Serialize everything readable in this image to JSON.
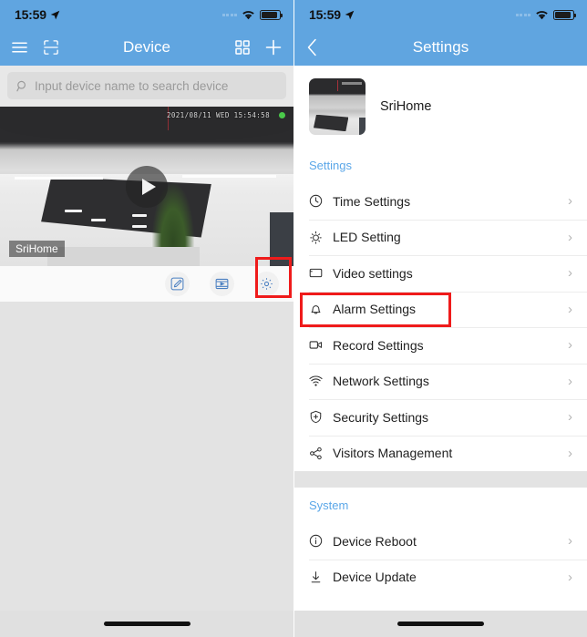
{
  "left": {
    "status": {
      "time": "15:59",
      "location_icon": "location-arrow-icon",
      "wifi_icon": "wifi-icon",
      "battery_icon": "battery-icon"
    },
    "nav": {
      "menu_icon": "hamburger-menu-icon",
      "scan_icon": "qr-scan-icon",
      "title": "Device",
      "grid_icon": "grid-view-icon",
      "add_icon": "plus-icon"
    },
    "search": {
      "placeholder": "Input device name to search device",
      "icon": "search-icon"
    },
    "device_card": {
      "timestamp": "2021/08/11  WED  15:54:58",
      "status_dot": "online-status-dot",
      "play_icon": "play-icon",
      "name_overlay": "SriHome",
      "actions": [
        {
          "name": "edit-device-button",
          "icon": "pencil-edit-icon"
        },
        {
          "name": "playback-button",
          "icon": "video-playback-icon"
        },
        {
          "name": "device-settings-button",
          "icon": "gear-icon",
          "highlighted": true
        }
      ]
    },
    "highlight_color": "#ef1b1b"
  },
  "right": {
    "status": {
      "time": "15:59",
      "location_icon": "location-arrow-icon",
      "wifi_icon": "wifi-icon",
      "battery_icon": "battery-icon"
    },
    "nav": {
      "back_icon": "chevron-left-icon",
      "title": "Settings"
    },
    "device": {
      "name": "SriHome",
      "thumbnail": "camera-snapshot-thumbnail"
    },
    "sections": [
      {
        "label": "Settings",
        "items": [
          {
            "label": "Time Settings",
            "icon": "clock-icon",
            "chevron": "›"
          },
          {
            "label": "LED Setting",
            "icon": "led-bulb-icon",
            "chevron": "›"
          },
          {
            "label": "Video settings",
            "icon": "video-frame-icon",
            "chevron": "›"
          },
          {
            "label": "Alarm Settings",
            "icon": "bell-icon",
            "chevron": "›",
            "highlighted": true
          },
          {
            "label": "Record Settings",
            "icon": "camcorder-icon",
            "chevron": "›"
          },
          {
            "label": "Network Settings",
            "icon": "wifi-icon",
            "chevron": "›"
          },
          {
            "label": "Security Settings",
            "icon": "shield-plus-icon",
            "chevron": "›"
          },
          {
            "label": "Visitors Management",
            "icon": "share-nodes-icon",
            "chevron": "›"
          }
        ]
      },
      {
        "label": "System",
        "items": [
          {
            "label": "Device Reboot",
            "icon": "info-circle-icon",
            "chevron": "›"
          },
          {
            "label": "Device Update",
            "icon": "download-arrow-icon",
            "chevron": "›"
          }
        ]
      }
    ],
    "accent_color": "#5ba7e8",
    "highlight_color": "#ef1b1b"
  }
}
